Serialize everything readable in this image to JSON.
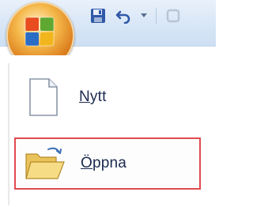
{
  "office_button": {
    "icon": "office-logo-icon"
  },
  "quick_access_toolbar": {
    "buttons": [
      {
        "icon": "save-icon"
      },
      {
        "icon": "undo-icon"
      },
      {
        "icon": "dropdown-arrow-icon"
      },
      {
        "icon": "repeat-icon"
      }
    ]
  },
  "menu": {
    "items": [
      {
        "label": "Nytt",
        "icon": "new-document-icon"
      },
      {
        "label": "Öppna",
        "icon": "open-folder-icon",
        "highlighted": true
      }
    ]
  },
  "colors": {
    "highlight_border": "#e04a4f",
    "label_text": "#1a2a4f",
    "titlebar": "#d8e6f6"
  }
}
